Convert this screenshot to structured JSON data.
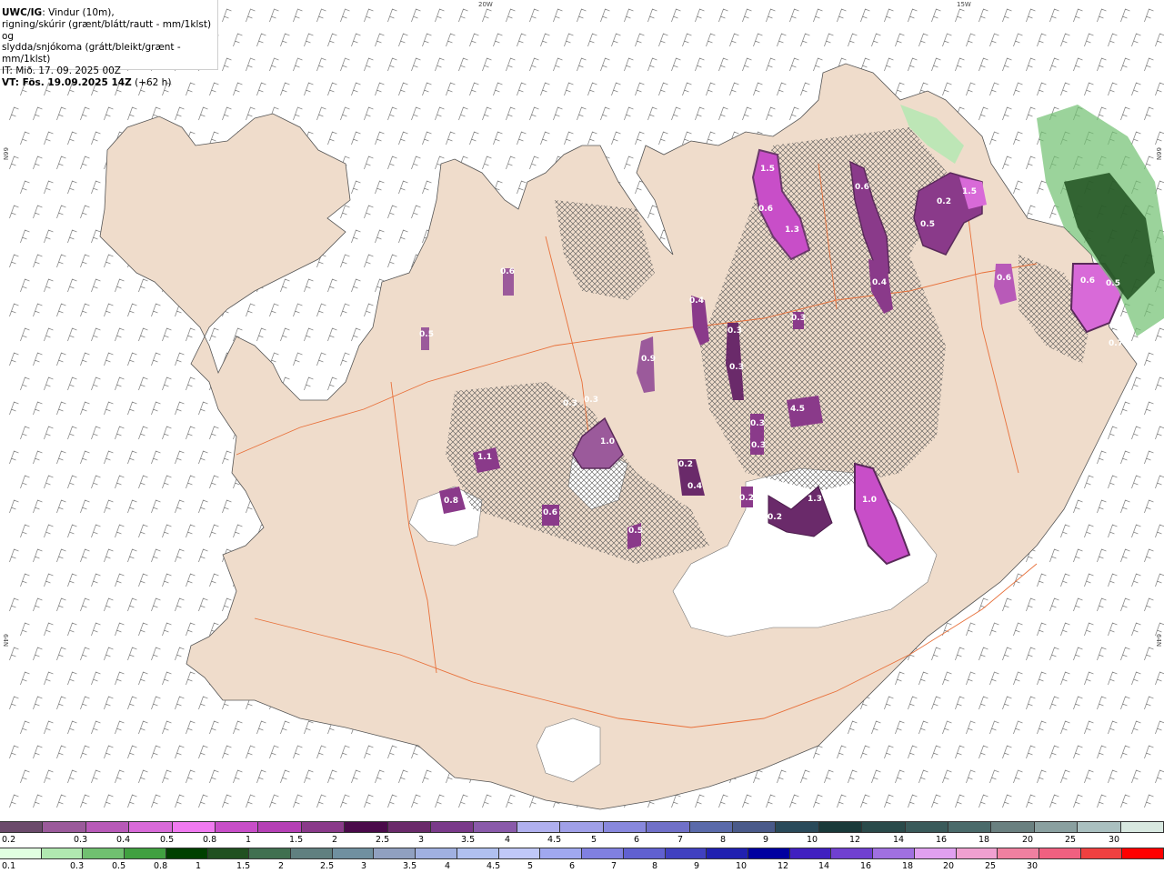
{
  "header": {
    "model": "UWC/IG",
    "line1_rest": ": Vindur (10m),",
    "line2": "rigning/skúrir (grænt/blátt/rautt - mm/1klst) og",
    "line3": "slydda/snjókoma (grátt/bleikt/grænt - mm/1klst)",
    "line4": "IT: Mið. 17. 09. 2025 00Z",
    "line5_bold": "VT: Fös. 19.09.2025 14Z",
    "line5_rest": " (+62 h)"
  },
  "graticule": {
    "lon_labels": [
      "20W",
      "15W"
    ],
    "lat_labels_left": [
      "66N",
      "64N"
    ],
    "lat_labels_right": [
      "66N",
      "64N"
    ]
  },
  "precip_labels": [
    "1.5",
    "0.6",
    "1.3",
    "0.6",
    "0.2",
    "1.5",
    "0.5",
    "0.6",
    "0.4",
    "0.6",
    "0.5",
    "0.4",
    "0.3",
    "0.3",
    "0.3",
    "0.5",
    "0.9",
    "0.3",
    "1.0",
    "0.3",
    "0.8",
    "0.6",
    "0.5",
    "0.4",
    "0.2",
    "0.3",
    "1.3",
    "0.2",
    "1.0",
    "0.6",
    "4.5",
    "1.1",
    "0.7",
    "0.3",
    "0.2"
  ],
  "legend": {
    "snow_colors": [
      "#6b4a6b",
      "#9b5a9b",
      "#b85ab8",
      "#d86ad8",
      "#f07af0",
      "#c84ec8",
      "#b540b5",
      "#8a3a8a",
      "#4a0a4a",
      "#6a2a6a",
      "#7a3a8a",
      "#8a5aaa",
      "#b0b0ee",
      "#a0a0e8",
      "#8888dd",
      "#7070c8",
      "#5a6aaa",
      "#4a5a8a",
      "#2a4a5a",
      "#1a3a3a",
      "#2a4a4a",
      "#3a5a5a",
      "#4a6a6a",
      "#6a8080",
      "#8aa0a0",
      "#aac0c0",
      "#d8e8e0"
    ],
    "snow_labels": [
      "0.2",
      "0.3",
      "0.4",
      "0.5",
      "0.8",
      "1",
      "1.5",
      "2",
      "2.5",
      "3",
      "3.5",
      "4",
      "4.5",
      "5",
      "6",
      "7",
      "8",
      "9",
      "10",
      "12",
      "14",
      "16",
      "18",
      "20",
      "25",
      "30"
    ],
    "rain_colors": [
      "#e0ffe0",
      "#b0e8b0",
      "#70c070",
      "#40a040",
      "#004000",
      "#205020",
      "#407050",
      "#608080",
      "#7090a0",
      "#90a0c0",
      "#a0b0e0",
      "#b0c0f0",
      "#c0c8f8",
      "#a0a8f0",
      "#8080e0",
      "#6060d0",
      "#4040c0",
      "#2020b0",
      "#0000a0",
      "#4020c0",
      "#7040d0",
      "#a070e0",
      "#e0a0f0",
      "#f0a0d0",
      "#f080a0",
      "#f06080",
      "#f04040",
      "#ff0000"
    ],
    "rain_labels": [
      "0.1",
      "0.3",
      "0.5",
      "0.8",
      "1",
      "1.5",
      "2",
      "2.5",
      "3",
      "3.5",
      "4",
      "4.5",
      "5",
      "6",
      "7",
      "8",
      "9",
      "10",
      "12",
      "14",
      "16",
      "18",
      "20",
      "25",
      "30"
    ]
  }
}
